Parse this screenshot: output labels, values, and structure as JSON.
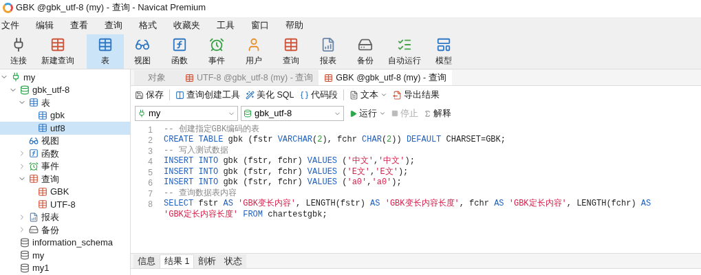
{
  "window": {
    "title": "GBK @gbk_utf-8 (my) - 查询 - Navicat Premium"
  },
  "menu": [
    "文件",
    "编辑",
    "查看",
    "查询",
    "格式",
    "收藏夹",
    "工具",
    "窗口",
    "帮助"
  ],
  "toolbar": [
    {
      "label": "连接",
      "kind": "connect",
      "selected": false
    },
    {
      "label": "新建查询",
      "kind": "newquery",
      "selected": false
    },
    {
      "label": "表",
      "kind": "table",
      "selected": true
    },
    {
      "label": "视图",
      "kind": "view",
      "selected": false
    },
    {
      "label": "函数",
      "kind": "function",
      "selected": false
    },
    {
      "label": "事件",
      "kind": "event",
      "selected": false
    },
    {
      "label": "用户",
      "kind": "user",
      "selected": false
    },
    {
      "label": "查询",
      "kind": "query",
      "selected": false
    },
    {
      "label": "报表",
      "kind": "report",
      "selected": false
    },
    {
      "label": "备份",
      "kind": "backup",
      "selected": false
    },
    {
      "label": "自动运行",
      "kind": "schedule",
      "selected": false
    },
    {
      "label": "模型",
      "kind": "model",
      "selected": false
    }
  ],
  "tree": [
    {
      "label": "my",
      "kind": "connection",
      "expanded": true,
      "selected": false,
      "children": [
        {
          "label": "gbk_utf-8",
          "kind": "database-open",
          "expanded": true,
          "selected": false,
          "children": [
            {
              "label": "表",
              "kind": "table",
              "expanded": true,
              "selected": false,
              "children": [
                {
                  "label": "gbk",
                  "kind": "table",
                  "selected": false
                },
                {
                  "label": "utf8",
                  "kind": "table",
                  "selected": true
                }
              ]
            },
            {
              "label": "视图",
              "kind": "view",
              "selected": false
            },
            {
              "label": "函数",
              "kind": "function",
              "expanded": false,
              "selected": false
            },
            {
              "label": "事件",
              "kind": "event",
              "expanded": false,
              "selected": false
            },
            {
              "label": "查询",
              "kind": "query",
              "expanded": true,
              "selected": false,
              "children": [
                {
                  "label": "GBK",
                  "kind": "query",
                  "selected": false
                },
                {
                  "label": "UTF-8",
                  "kind": "query",
                  "selected": false
                }
              ]
            },
            {
              "label": "报表",
              "kind": "report",
              "expanded": false,
              "selected": false
            },
            {
              "label": "备份",
              "kind": "backup",
              "expanded": false,
              "selected": false
            }
          ]
        },
        {
          "label": "information_schema",
          "kind": "database",
          "selected": false
        },
        {
          "label": "my",
          "kind": "database",
          "selected": false
        },
        {
          "label": "my1",
          "kind": "database",
          "selected": false
        }
      ]
    }
  ],
  "tabs": [
    {
      "label": "对象",
      "kind": "plain",
      "selected": false
    },
    {
      "label": "UTF-8 @gbk_utf-8 (my) - 查询",
      "kind": "query",
      "selected": false
    },
    {
      "label": "GBK @gbk_utf-8 (my) - 查询",
      "kind": "query",
      "selected": true
    }
  ],
  "editor_toolbar": [
    {
      "label": "保存",
      "kind": "save"
    },
    {
      "label": "查询创建工具",
      "kind": "builder"
    },
    {
      "label": "美化 SQL",
      "kind": "beautify"
    },
    {
      "label": "代码段",
      "kind": "snippet"
    },
    {
      "label": "文本",
      "kind": "text"
    },
    {
      "label": "导出结果",
      "kind": "export"
    }
  ],
  "connection_select": {
    "value": "my"
  },
  "database_select": {
    "value": "gbk_utf-8"
  },
  "run_controls": [
    {
      "label": "运行",
      "kind": "run",
      "disabled": false
    },
    {
      "label": "停止",
      "kind": "stop",
      "disabled": true
    },
    {
      "label": "解释",
      "kind": "explain",
      "disabled": false
    }
  ],
  "code": [
    {
      "number": "1",
      "tokens": [
        {
          "kind": "comment",
          "t": "-- 创建指定GBK编码的表"
        }
      ]
    },
    {
      "number": "2",
      "tokens": [
        {
          "kind": "kw",
          "t": "CREATE TABLE"
        },
        {
          "kind": "plain",
          "t": " gbk (fstr "
        },
        {
          "kind": "kw",
          "t": "VARCHAR"
        },
        {
          "kind": "plain",
          "t": "("
        },
        {
          "kind": "num",
          "t": "2"
        },
        {
          "kind": "plain",
          "t": "), fchr "
        },
        {
          "kind": "kw",
          "t": "CHAR"
        },
        {
          "kind": "plain",
          "t": "("
        },
        {
          "kind": "num",
          "t": "2"
        },
        {
          "kind": "plain",
          "t": ")) "
        },
        {
          "kind": "kw",
          "t": "DEFAULT"
        },
        {
          "kind": "plain",
          "t": " CHARSET=GBK;"
        }
      ]
    },
    {
      "number": "3",
      "tokens": [
        {
          "kind": "comment",
          "t": "-- 写入测试数据"
        }
      ]
    },
    {
      "number": "4",
      "tokens": [
        {
          "kind": "kw",
          "t": "INSERT INTO"
        },
        {
          "kind": "plain",
          "t": " gbk (fstr, fchr) "
        },
        {
          "kind": "kw",
          "t": "VALUES"
        },
        {
          "kind": "plain",
          "t": " ("
        },
        {
          "kind": "str",
          "t": "'中文'"
        },
        {
          "kind": "plain",
          "t": ","
        },
        {
          "kind": "str",
          "t": "'中文'"
        },
        {
          "kind": "plain",
          "t": ");"
        }
      ]
    },
    {
      "number": "5",
      "tokens": [
        {
          "kind": "kw",
          "t": "INSERT INTO"
        },
        {
          "kind": "plain",
          "t": " gbk (fstr, fchr) "
        },
        {
          "kind": "kw",
          "t": "VALUES"
        },
        {
          "kind": "plain",
          "t": " ("
        },
        {
          "kind": "str",
          "t": "'E文'"
        },
        {
          "kind": "plain",
          "t": ","
        },
        {
          "kind": "str",
          "t": "'E文'"
        },
        {
          "kind": "plain",
          "t": ");"
        }
      ]
    },
    {
      "number": "6",
      "tokens": [
        {
          "kind": "kw",
          "t": "INSERT INTO"
        },
        {
          "kind": "plain",
          "t": " gbk (fstr, fchr) "
        },
        {
          "kind": "kw",
          "t": "VALUES"
        },
        {
          "kind": "plain",
          "t": " ("
        },
        {
          "kind": "str",
          "t": "'a0'"
        },
        {
          "kind": "plain",
          "t": ","
        },
        {
          "kind": "str",
          "t": "'a0'"
        },
        {
          "kind": "plain",
          "t": ");"
        }
      ]
    },
    {
      "number": "7",
      "tokens": [
        {
          "kind": "comment",
          "t": "-- 查询数据表内容"
        }
      ]
    },
    {
      "number": "8",
      "tokens": [
        {
          "kind": "kw",
          "t": "SELECT"
        },
        {
          "kind": "plain",
          "t": " fstr "
        },
        {
          "kind": "kw",
          "t": "AS "
        },
        {
          "kind": "str",
          "t": "'GBK变长内容'"
        },
        {
          "kind": "plain",
          "t": ", LENGTH(fstr) "
        },
        {
          "kind": "kw",
          "t": "AS "
        },
        {
          "kind": "str",
          "t": "'GBK变长内容长度'"
        },
        {
          "kind": "plain",
          "t": ", fchr "
        },
        {
          "kind": "kw",
          "t": "AS "
        },
        {
          "kind": "str",
          "t": "'GBK定长内容'"
        },
        {
          "kind": "plain",
          "t": ", LENGTH(fchr) "
        },
        {
          "kind": "kw",
          "t": "AS"
        }
      ]
    },
    {
      "tokens": [
        {
          "kind": "str",
          "t": "'GBK定长内容长度'"
        },
        {
          "kind": "kw",
          "t": " FROM"
        },
        {
          "kind": "plain",
          "t": " chartestgbk;"
        }
      ]
    }
  ],
  "result_tabs": [
    {
      "label": "信息",
      "selected": false
    },
    {
      "label": "结果 1",
      "selected": true
    },
    {
      "label": "剖析",
      "selected": false
    },
    {
      "label": "状态",
      "selected": false
    }
  ]
}
